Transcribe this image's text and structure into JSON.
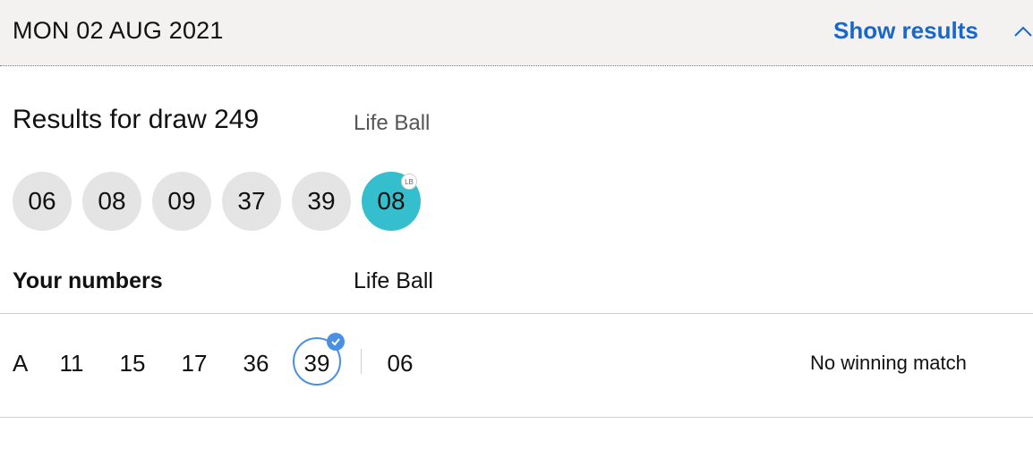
{
  "header": {
    "draw_date": "MON 02 AUG 2021",
    "show_results_label": "Show results",
    "toggle_icon": "chevron-up-icon"
  },
  "results": {
    "title": "Results for draw 249",
    "lifeball_label": "Life Ball",
    "numbers": [
      "06",
      "08",
      "09",
      "37",
      "39"
    ],
    "life_ball": "08",
    "life_ball_badge": "LB"
  },
  "your_numbers": {
    "heading": "Your numbers",
    "lifeball_heading": "Life Ball",
    "lines": [
      {
        "letter": "A",
        "numbers": [
          "11",
          "15",
          "17",
          "36",
          "39"
        ],
        "matched": [
          "39"
        ],
        "life_ball": "06",
        "result": "No winning match"
      }
    ]
  },
  "colors": {
    "accent_blue": "#1a66c9",
    "life_ball": "#35bfce",
    "match_ring": "#4a90e2",
    "ball_grey": "#e4e4e4",
    "header_bg": "#f3f2f1"
  }
}
